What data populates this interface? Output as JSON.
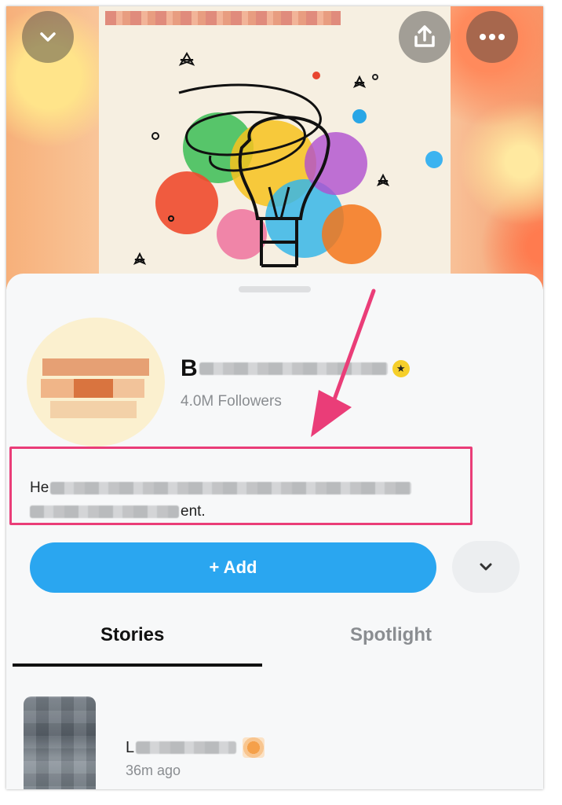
{
  "header": {
    "collapse_icon": "chevron-down-icon",
    "share_icon": "share-upload-icon",
    "more_icon": "more-horizontal-icon"
  },
  "profile": {
    "name_visible": "B",
    "followers": "4.0M Followers",
    "verified_icon": "star-badge-icon"
  },
  "bio": {
    "line1_start": "He",
    "line2_end": "ent."
  },
  "actions": {
    "add_label": "+ Add",
    "more_icon": "chevron-down-icon"
  },
  "tabs": [
    {
      "label": "Stories",
      "active": true
    },
    {
      "label": "Spotlight",
      "active": false
    }
  ],
  "stories": [
    {
      "title_visible": "L",
      "time": "36m ago"
    }
  ],
  "colors": {
    "accent": "#2aa6f0",
    "annotation": "#ea3d78",
    "badge": "#f6cf2a"
  }
}
